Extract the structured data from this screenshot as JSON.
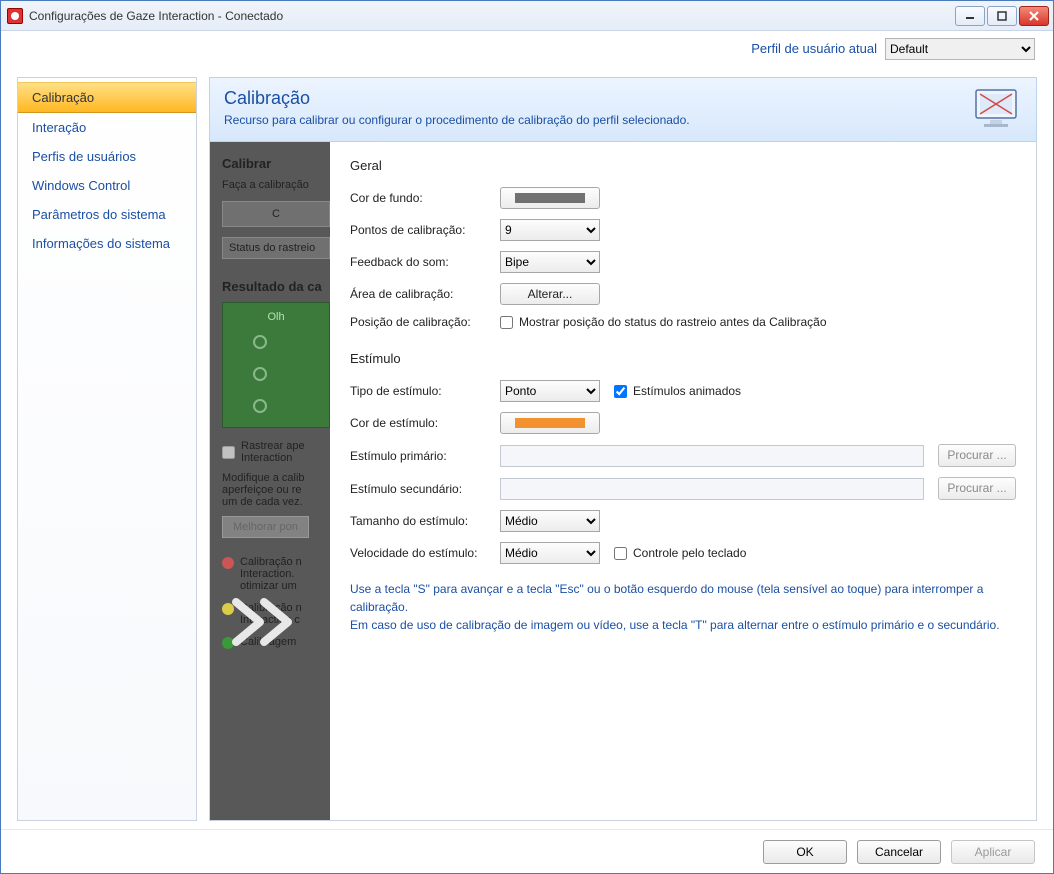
{
  "window": {
    "title": "Configurações de Gaze Interaction - Conectado"
  },
  "profile": {
    "label": "Perfil de usuário atual",
    "value": "Default"
  },
  "sidebar": {
    "items": [
      {
        "label": "Calibração",
        "active": true
      },
      {
        "label": "Interação",
        "active": false
      },
      {
        "label": "Perfis de usuários",
        "active": false
      },
      {
        "label": "Windows Control",
        "active": false
      },
      {
        "label": "Parâmetros do sistema",
        "active": false
      },
      {
        "label": "Informações do sistema",
        "active": false
      }
    ]
  },
  "header": {
    "title": "Calibração",
    "desc": "Recurso para calibrar ou configurar o procedimento de calibração do perfil selecionado."
  },
  "back_panel": {
    "calibrar_title": "Calibrar",
    "calibrar_sub": "Faça a calibração",
    "box1": "C",
    "box2": "Status do rastreio",
    "resultado_title": "Resultado da ca",
    "olho_label": "Olh",
    "check_line1": "Rastrear ape",
    "check_line2": "Interaction",
    "modify_l1": "Modifique a calib",
    "modify_l2": "aperfeiçoe ou re",
    "modify_l3": "um de cada vez.",
    "melhorar_btn": "Melhorar pon",
    "bullet1_l1": "Calibração n",
    "bullet1_l2": "Interaction.",
    "bullet1_l3": "otimizar um",
    "bullet2_l1": "Calibração n",
    "bullet2_l2": "Interaction c",
    "bullet3_l1": "Calibragem"
  },
  "form": {
    "geral": {
      "title": "Geral",
      "cor_fundo_label": "Cor de fundo:",
      "cor_fundo_color": "#707070",
      "pontos_label": "Pontos de calibração:",
      "pontos_value": "9",
      "feedback_label": "Feedback do som:",
      "feedback_value": "Bipe",
      "area_label": "Área de calibração:",
      "area_button": "Alterar...",
      "pos_label": "Posição de calibração:",
      "pos_check_label": "Mostrar posição do status do rastreio antes da Calibração"
    },
    "estimulo": {
      "title": "Estímulo",
      "tipo_label": "Tipo de estímulo:",
      "tipo_value": "Ponto",
      "animados_label": "Estímulos animados",
      "cor_label": "Cor de estímulo:",
      "cor_color": "#f2922f",
      "prim_label": "Estímulo primário:",
      "sec_label": "Estímulo secundário:",
      "browse_label": "Procurar ...",
      "tamanho_label": "Tamanho do estímulo:",
      "tamanho_value": "Médio",
      "veloc_label": "Velocidade do estímulo:",
      "veloc_value": "Médio",
      "teclado_label": "Controle pelo teclado"
    },
    "note": {
      "l1": "Use a tecla \"S\" para avançar e a tecla \"Esc\" ou o botão esquerdo do mouse (tela sensível ao toque) para interromper a calibração.",
      "l2": "Em caso de uso de calibração de imagem ou vídeo, use a tecla \"T\" para alternar entre o estímulo primário e o secundário."
    }
  },
  "footer": {
    "ok": "OK",
    "cancel": "Cancelar",
    "apply": "Aplicar"
  }
}
